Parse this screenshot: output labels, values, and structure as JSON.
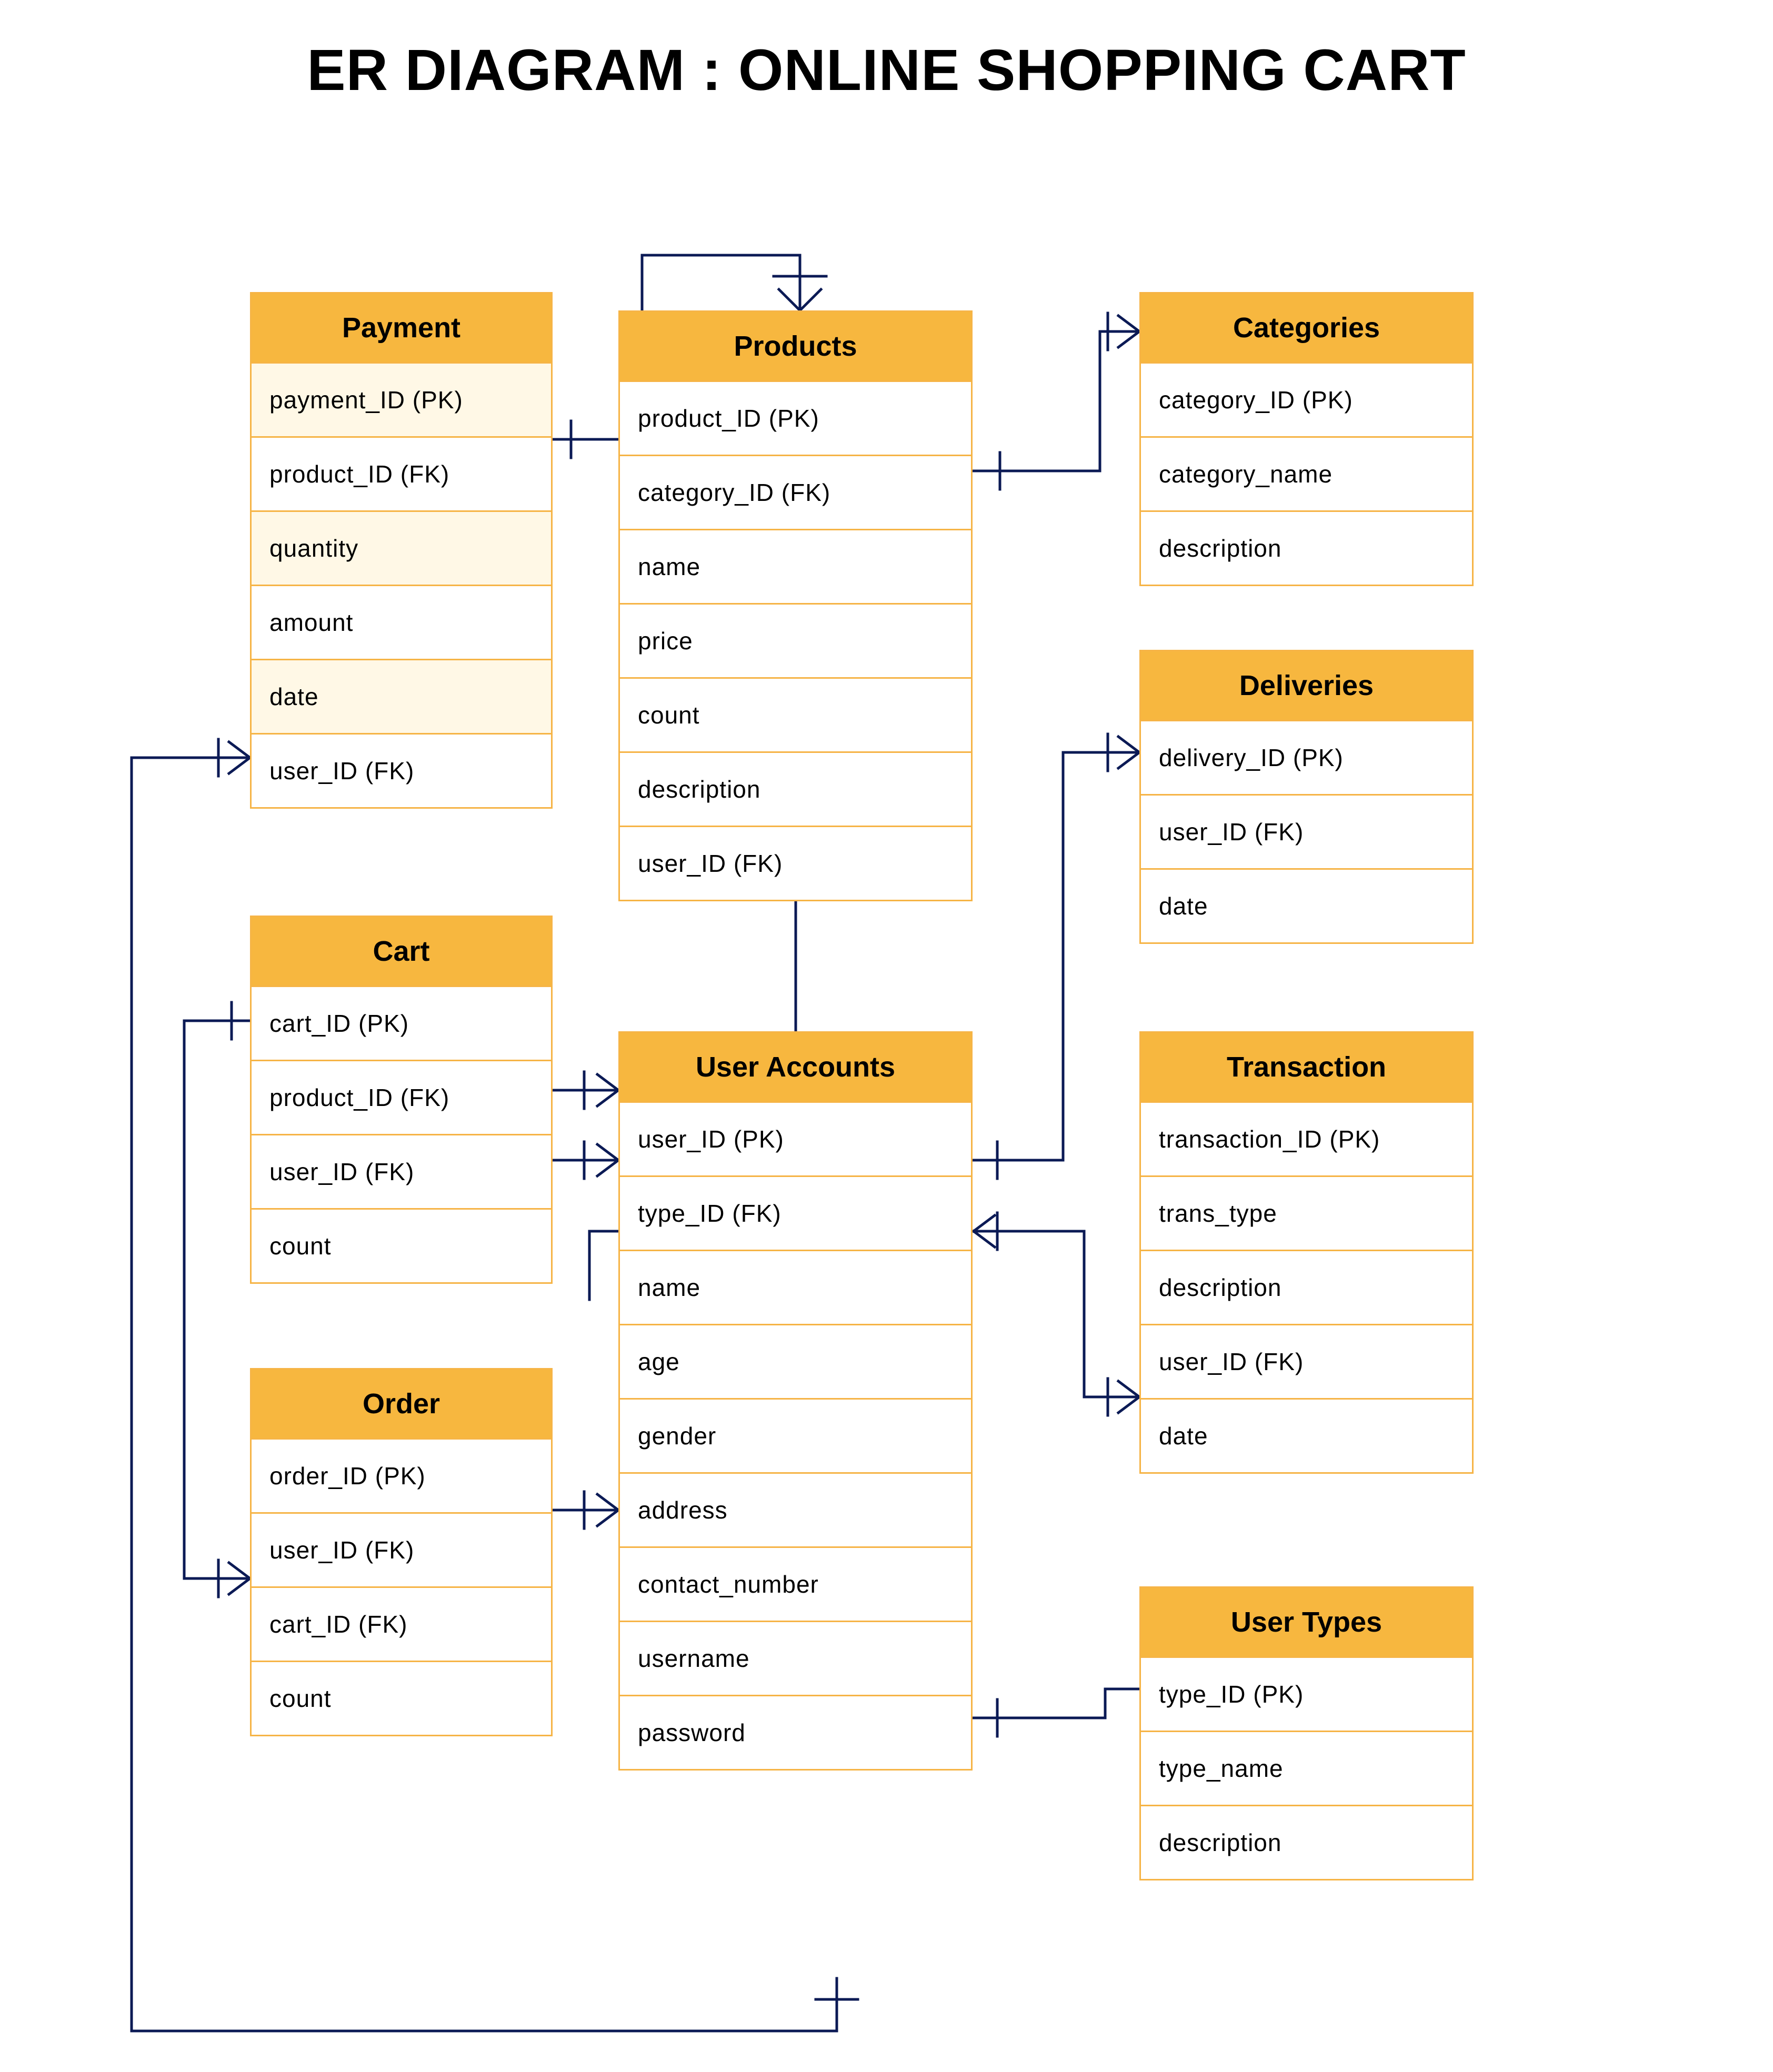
{
  "title": "ER DIAGRAM : ONLINE SHOPPING CART",
  "entities": {
    "payment": {
      "name": "Payment",
      "fields": [
        "payment_ID (PK)",
        "product_ID (FK)",
        "quantity",
        "amount",
        "date",
        "user_ID (FK)"
      ]
    },
    "products": {
      "name": "Products",
      "fields": [
        "product_ID (PK)",
        "category_ID (FK)",
        "name",
        "price",
        "count",
        "description",
        "user_ID (FK)"
      ]
    },
    "categories": {
      "name": "Categories",
      "fields": [
        "category_ID (PK)",
        "category_name",
        "description"
      ]
    },
    "cart": {
      "name": "Cart",
      "fields": [
        "cart_ID (PK)",
        "product_ID (FK)",
        "user_ID (FK)",
        "count"
      ]
    },
    "deliveries": {
      "name": "Deliveries",
      "fields": [
        "delivery_ID (PK)",
        "user_ID (FK)",
        "date"
      ]
    },
    "user_accounts": {
      "name": "User Accounts",
      "fields": [
        "user_ID (PK)",
        "type_ID (FK)",
        "name",
        "age",
        "gender",
        "address",
        "contact_number",
        "username",
        "password"
      ]
    },
    "transaction": {
      "name": "Transaction",
      "fields": [
        "transaction_ID (PK)",
        "trans_type",
        "description",
        "user_ID (FK)",
        "date"
      ]
    },
    "order": {
      "name": "Order",
      "fields": [
        "order_ID (PK)",
        "user_ID (FK)",
        "cart_ID (FK)",
        "count"
      ]
    },
    "user_types": {
      "name": "User Types",
      "fields": [
        "type_ID (PK)",
        "type_name",
        "description"
      ]
    }
  },
  "colors": {
    "header_bg": "#f7b73f",
    "border": "#f6b446",
    "connector": "#0b1a55",
    "tint": "#fff8e6"
  }
}
